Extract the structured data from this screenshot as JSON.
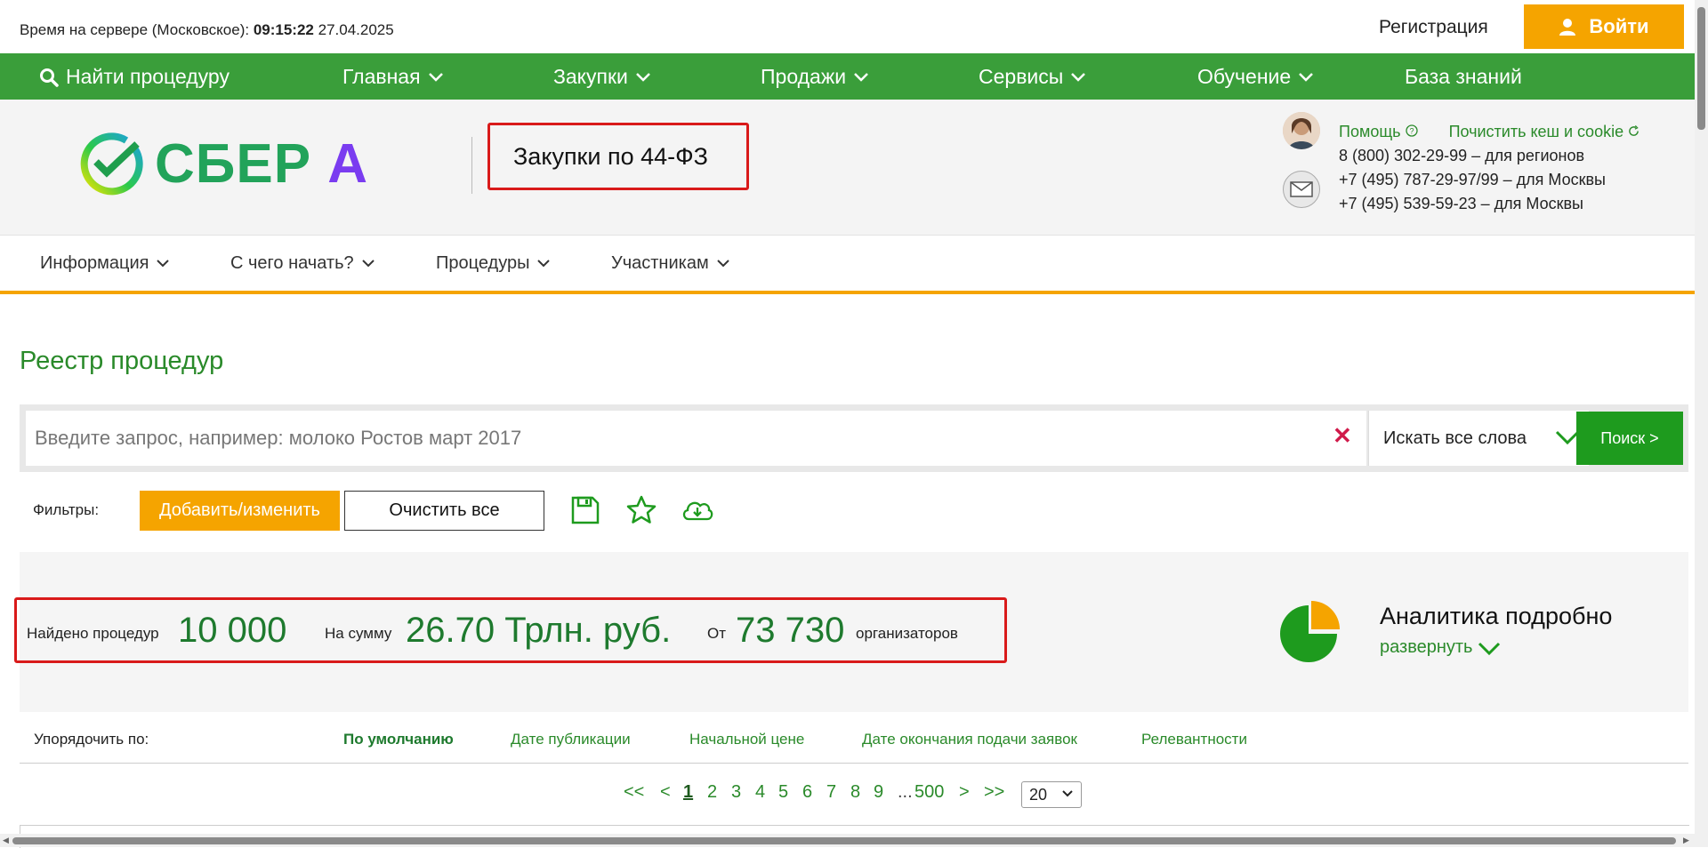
{
  "topbar": {
    "server_time_label": "Время на сервере (Московское):",
    "server_time": "09:15:22",
    "server_date": "27.04.2025",
    "register": "Регистрация",
    "login": "Войти"
  },
  "main_nav": {
    "search": "Найти процедуру",
    "items": [
      "Главная",
      "Закупки",
      "Продажи",
      "Сервисы",
      "Обучение",
      "База знаний"
    ]
  },
  "brand": {
    "logo_text": "СБЕР",
    "logo_letter": "А",
    "section": "Закупки по 44-ФЗ"
  },
  "contacts": {
    "help": "Помощь",
    "clear_cache": "Почистить кеш и cookie",
    "phones": [
      " 8 (800) 302-29-99 – для регионов",
      "+7 (495) 787-29-97/99 – для Москвы",
      "+7 (495) 539-59-23 – для Москвы"
    ]
  },
  "sub_nav": {
    "items": [
      "Информация",
      "С чего начать?",
      "Процедуры",
      "Участникам"
    ]
  },
  "page_title": "Реестр процедур",
  "search": {
    "placeholder": "Введите запрос, например: молоко Ростов март 2017",
    "mode": "Искать все слова",
    "button": "Поиск >"
  },
  "filters": {
    "label": "Фильтры:",
    "add": "Добавить/изменить",
    "clear": "Очистить все"
  },
  "stats": {
    "found_label": "Найдено процедур",
    "found_value": "10 000",
    "sum_label": "На сумму",
    "sum_value": "26.70 Трлн. руб.",
    "from_label": "От",
    "from_value": "73 730",
    "org_label": "организаторов"
  },
  "analytics": {
    "title": "Аналитика подробно",
    "expand": "развернуть",
    "pie_share": 0.25,
    "colors": {
      "main": "#1e9b1e",
      "slice": "#f5a400"
    }
  },
  "sort": {
    "label": "Упорядочить по:",
    "options": [
      "По умолчанию",
      "Дате публикации",
      "Начальной цене",
      "Дате окончания подачи заявок",
      "Релевантности"
    ],
    "active": "По умолчанию"
  },
  "pagination": {
    "first": "<<",
    "prev": "<",
    "pages": [
      "1",
      "2",
      "3",
      "4",
      "5",
      "6",
      "7",
      "8",
      "9"
    ],
    "current": "1",
    "ellipsis": "...",
    "last_page": "500",
    "next": ">",
    "last": ">>",
    "page_size": "20"
  },
  "colors": {
    "brand_green": "#3a9e3a",
    "accent_orange": "#f5a400",
    "highlight_red": "#d91a1a"
  }
}
